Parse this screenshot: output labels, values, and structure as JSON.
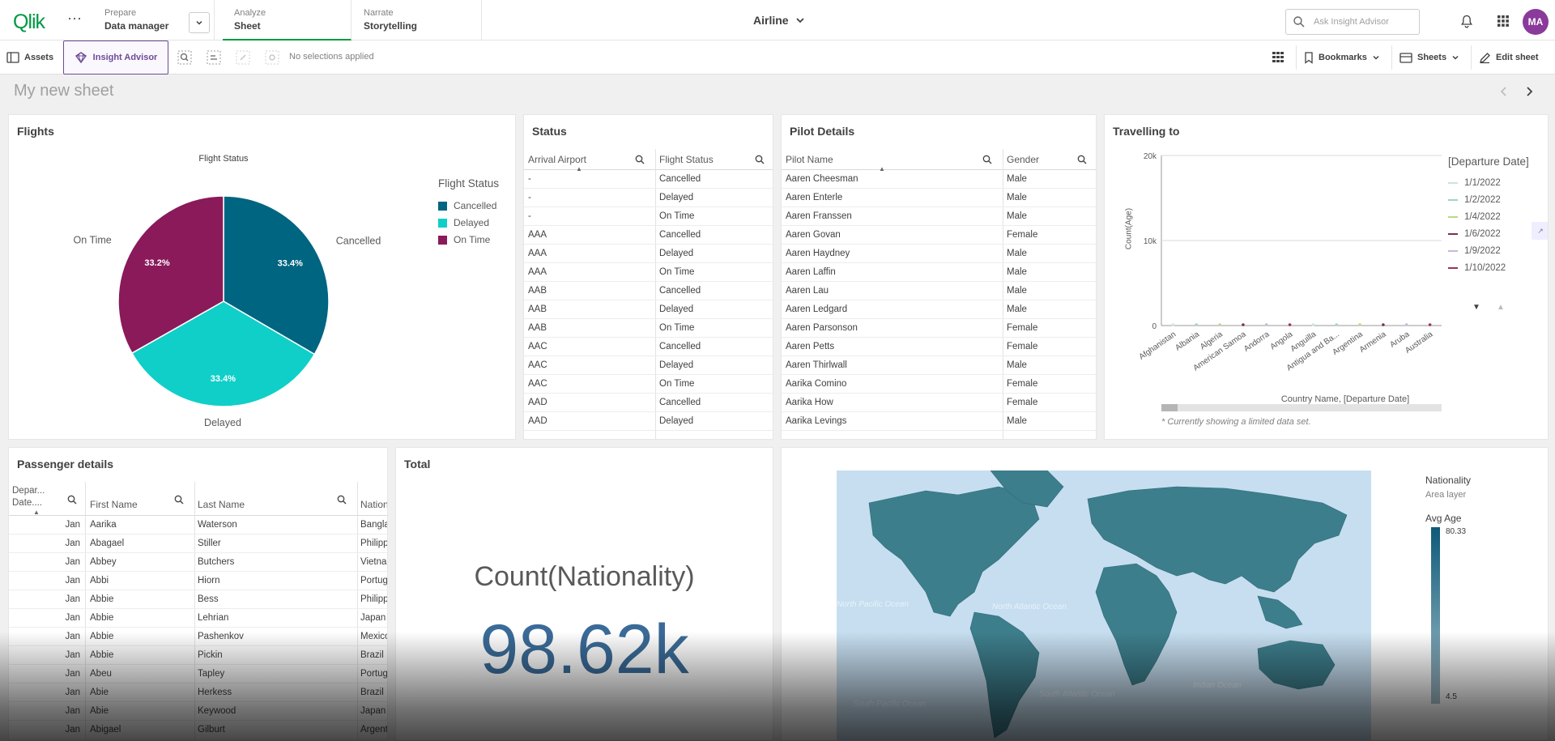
{
  "header": {
    "logo": "Qlik",
    "prepare_label": "Prepare",
    "prepare_value": "Data manager",
    "analyze_label": "Analyze",
    "analyze_value": "Sheet",
    "narrate_label": "Narrate",
    "narrate_value": "Storytelling",
    "app_name": "Airline",
    "search_placeholder": "Ask Insight Advisor",
    "avatar": "MA"
  },
  "toolbar": {
    "assets": "Assets",
    "insight_advisor": "Insight Advisor",
    "no_selections": "No selections applied",
    "bookmarks": "Bookmarks",
    "sheets": "Sheets",
    "edit_sheet": "Edit sheet"
  },
  "sheet": {
    "title": "My new sheet"
  },
  "flights": {
    "title": "Flights",
    "subtitle": "Flight Status",
    "legend_title": "Flight Status",
    "labels": {
      "cancelled": "Cancelled",
      "delayed": "Delayed",
      "ontime": "On Time"
    },
    "pct": {
      "cancelled": "33.4%",
      "delayed": "33.4%",
      "ontime": "33.2%"
    },
    "colors": {
      "cancelled": "#006580",
      "delayed": "#10cfc9",
      "ontime": "#8a1a5a"
    }
  },
  "chart_data": {
    "type": "pie",
    "title": "Flight Status",
    "categories": [
      "Cancelled",
      "Delayed",
      "On Time"
    ],
    "values": [
      33.4,
      33.4,
      33.2
    ],
    "legend_position": "right"
  },
  "status": {
    "title": "Status",
    "col1": "Arrival Airport",
    "col2": "Flight Status",
    "rows": [
      [
        "-",
        "Cancelled"
      ],
      [
        "-",
        "Delayed"
      ],
      [
        "-",
        "On Time"
      ],
      [
        "AAA",
        "Cancelled"
      ],
      [
        "AAA",
        "Delayed"
      ],
      [
        "AAA",
        "On Time"
      ],
      [
        "AAB",
        "Cancelled"
      ],
      [
        "AAB",
        "Delayed"
      ],
      [
        "AAB",
        "On Time"
      ],
      [
        "AAC",
        "Cancelled"
      ],
      [
        "AAC",
        "Delayed"
      ],
      [
        "AAC",
        "On Time"
      ],
      [
        "AAD",
        "Cancelled"
      ],
      [
        "AAD",
        "Delayed"
      ]
    ]
  },
  "pilot": {
    "title": "Pilot Details",
    "col1": "Pilot Name",
    "col2": "Gender",
    "rows": [
      [
        "Aaren Cheesman",
        "Male"
      ],
      [
        "Aaren Enterle",
        "Male"
      ],
      [
        "Aaren Franssen",
        "Male"
      ],
      [
        "Aaren Govan",
        "Female"
      ],
      [
        "Aaren Haydney",
        "Male"
      ],
      [
        "Aaren Laffin",
        "Male"
      ],
      [
        "Aaren Lau",
        "Male"
      ],
      [
        "Aaren Ledgard",
        "Male"
      ],
      [
        "Aaren Parsonson",
        "Female"
      ],
      [
        "Aaren Petts",
        "Female"
      ],
      [
        "Aaren Thirlwall",
        "Male"
      ],
      [
        "Aarika Comino",
        "Female"
      ],
      [
        "Aarika How",
        "Female"
      ],
      [
        "Aarika Levings",
        "Male"
      ]
    ]
  },
  "travel": {
    "title": "Travelling to",
    "ylabel": "Count(Age)",
    "xlabel": "Country Name, [Departure Date]",
    "yticks": [
      "20k",
      "10k",
      "0"
    ],
    "legend_title": "[Departure Date]",
    "legend": [
      "1/1/2022",
      "1/2/2022",
      "1/4/2022",
      "1/6/2022",
      "1/9/2022",
      "1/10/2022"
    ],
    "legend_colors": [
      "#c8e6e0",
      "#9fd6c0",
      "#b7d98a",
      "#7a2e5a",
      "#c9b6d9",
      "#a0305a"
    ],
    "countries": [
      "Afghanistan",
      "Albania",
      "Algeria",
      "American Samoa",
      "Andorra",
      "Angola",
      "Anguilla",
      "Antigua and Ba...",
      "Argentina",
      "Armenia",
      "Aruba",
      "Australia"
    ],
    "note": "* Currently showing a limited data set."
  },
  "passenger": {
    "title": "Passenger details",
    "col_date": "Depar... Date....",
    "col_first": "First Name",
    "col_last": "Last Name",
    "col_nat": "Nation",
    "rows": [
      [
        "Jan",
        "Aarika",
        "Waterson",
        "Bangla"
      ],
      [
        "Jan",
        "Abagael",
        "Stiller",
        "Philipp"
      ],
      [
        "Jan",
        "Abbey",
        "Butchers",
        "Vietna"
      ],
      [
        "Jan",
        "Abbi",
        "Hiorn",
        "Portug"
      ],
      [
        "Jan",
        "Abbie",
        "Bess",
        "Philipp"
      ],
      [
        "Jan",
        "Abbie",
        "Lehrian",
        "Japan"
      ],
      [
        "Jan",
        "Abbie",
        "Pashenkov",
        "Mexico"
      ],
      [
        "Jan",
        "Abbie",
        "Pickin",
        "Brazil"
      ],
      [
        "Jan",
        "Abeu",
        "Tapley",
        "Portug"
      ],
      [
        "Jan",
        "Abie",
        "Herkess",
        "Brazil"
      ],
      [
        "Jan",
        "Abie",
        "Keywood",
        "Japan"
      ],
      [
        "Jan",
        "Abigael",
        "Gilburt",
        "Argent"
      ]
    ]
  },
  "total": {
    "title": "Total",
    "label": "Count(Nationality)",
    "value": "98.62k"
  },
  "map": {
    "legend_title": "Nationality",
    "legend_sub": "Area layer",
    "measure": "Avg Age",
    "max": "80.33",
    "min": "4.5",
    "oceans": [
      "North Pacific Ocean",
      "North Atlantic Ocean",
      "South Pacific Ocean",
      "South Atlantic Ocean",
      "Indian Ocean"
    ]
  }
}
